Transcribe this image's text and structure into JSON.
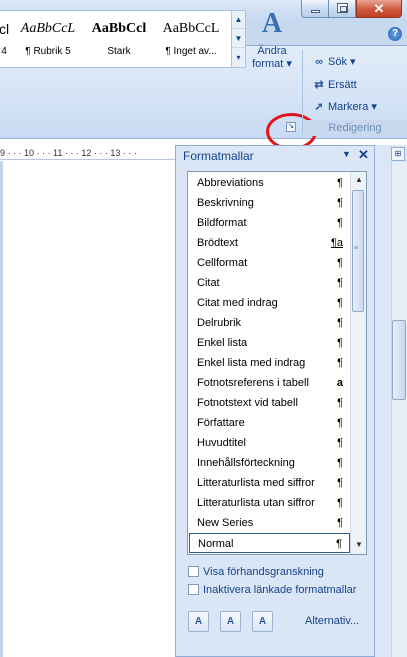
{
  "help": {
    "glyph": "?"
  },
  "window": {
    "minimize_glyph": "",
    "close_glyph": "✕"
  },
  "ribbon": {
    "quick_styles": [
      {
        "sample": "cl",
        "label": "4"
      },
      {
        "sample": "AaBbCcL",
        "label": "¶ Rubrik 5"
      },
      {
        "sample": "AaBbCcl",
        "label": "Stark"
      },
      {
        "sample": "AaBbCcL",
        "label": "¶ Inget av..."
      }
    ],
    "gallery_up": "▲",
    "gallery_down": "▼",
    "gallery_more": "▾",
    "change_styles_label_1": "Ändra",
    "change_styles_label_2": "format ▾",
    "change_styles_icon_text": "A",
    "launcher_glyph": "↘",
    "editing": {
      "find": "Sök ▾",
      "replace": "Ersätt",
      "select": "Markera ▾",
      "group_label": "Redigering"
    }
  },
  "ruler": {
    "text": "9 · · · 10 · · · 11 · · · 12 · · · 13 · · ·"
  },
  "styles_pane": {
    "title": "Formatmallar",
    "menu_glyph": "▼",
    "close_glyph": "✕",
    "items": [
      {
        "name": "Abbreviations",
        "mark": "¶"
      },
      {
        "name": "Beskrivning",
        "mark": "¶"
      },
      {
        "name": "Bildformat",
        "mark": "¶"
      },
      {
        "name": "Brödtext",
        "mark": "¶a"
      },
      {
        "name": "Cellformat",
        "mark": "¶"
      },
      {
        "name": "Citat",
        "mark": "¶"
      },
      {
        "name": "Citat med indrag",
        "mark": "¶"
      },
      {
        "name": "Delrubrik",
        "mark": "¶"
      },
      {
        "name": "Enkel lista",
        "mark": "¶"
      },
      {
        "name": "Enkel lista med indrag",
        "mark": "¶"
      },
      {
        "name": "Fotnotsreferens i tabell",
        "mark": "a"
      },
      {
        "name": "Fotnotstext vid tabell",
        "mark": "¶"
      },
      {
        "name": "Författare",
        "mark": "¶"
      },
      {
        "name": "Huvudtitel",
        "mark": "¶"
      },
      {
        "name": "Innehållsförteckning",
        "mark": "¶"
      },
      {
        "name": "Litteraturlista med siffror",
        "mark": "¶"
      },
      {
        "name": "Litteraturlista utan siffror",
        "mark": "¶"
      },
      {
        "name": "New Series",
        "mark": "¶"
      },
      {
        "name": "Normal",
        "mark": "¶",
        "selected": true
      }
    ],
    "scroll_up": "▲",
    "scroll_down": "▼",
    "show_preview": "Visa förhandsgranskning",
    "disable_linked": "Inaktivera länkade formatmallar",
    "btn_new_style": "A",
    "btn_inspector": "A",
    "btn_manage": "A",
    "options_link": "Alternativ..."
  }
}
